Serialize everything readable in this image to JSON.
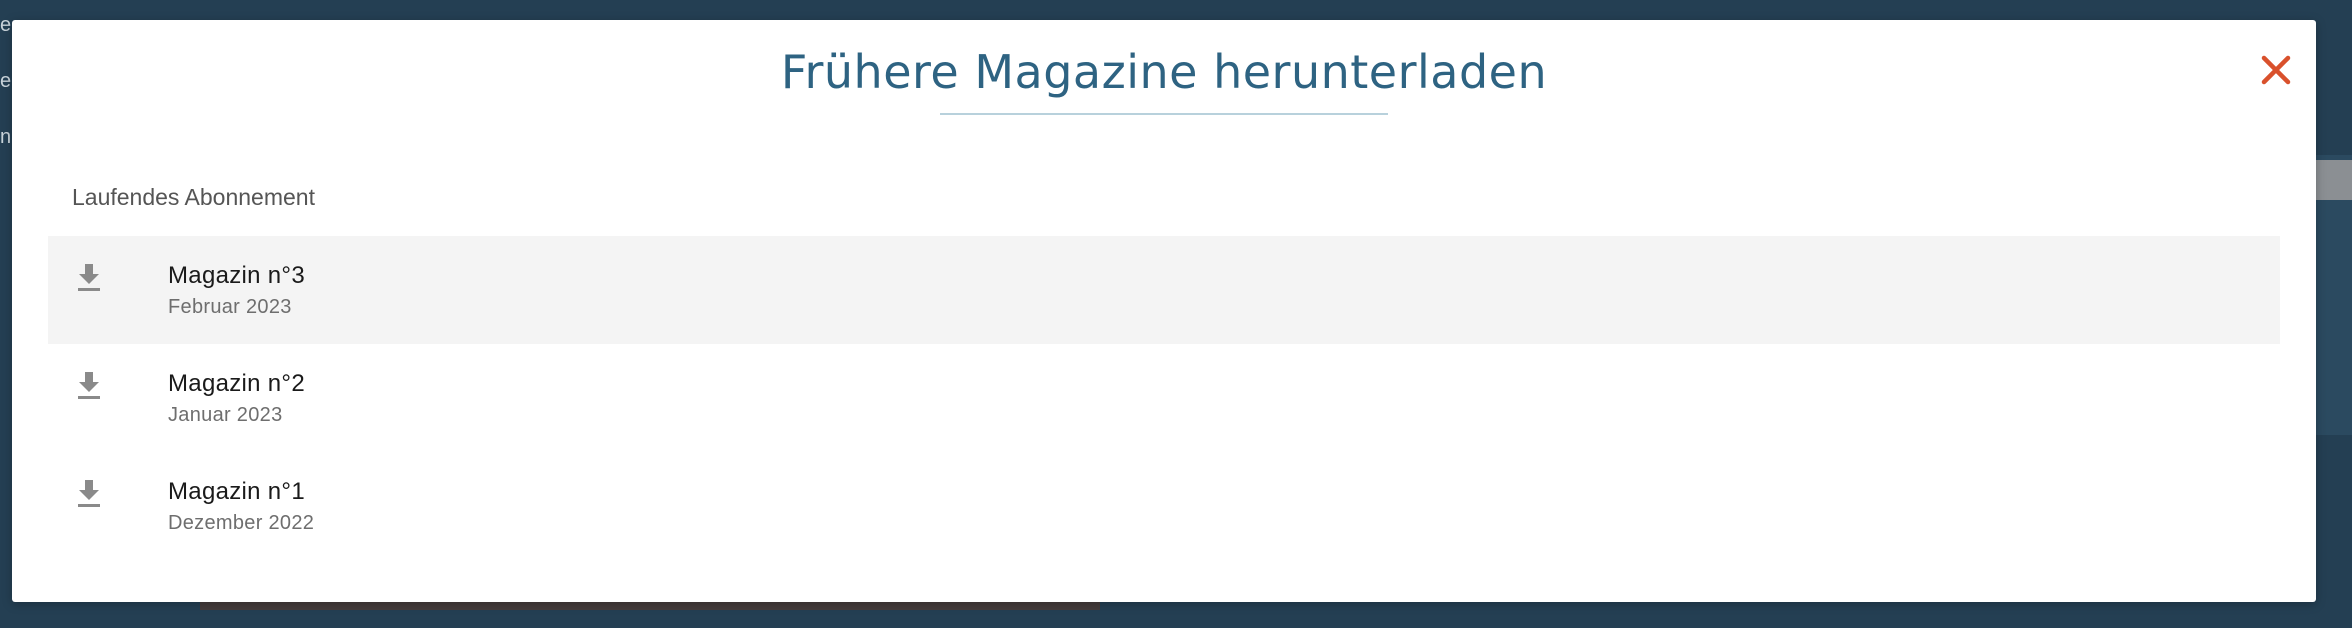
{
  "background": {
    "line_1": "e",
    "line_2": "e",
    "line_3": "n"
  },
  "modal": {
    "title": "Frühere Magazine herunterladen",
    "close_icon": "close-icon",
    "section_label": "Laufendes Abonnement",
    "items": [
      {
        "title": "Magazin n°3",
        "date": "Februar 2023",
        "icon": "download-icon",
        "highlighted": true
      },
      {
        "title": "Magazin n°2",
        "date": "Januar 2023",
        "icon": "download-icon",
        "highlighted": false
      },
      {
        "title": "Magazin n°1",
        "date": "Dezember 2022",
        "icon": "download-icon",
        "highlighted": false
      }
    ]
  },
  "colors": {
    "title": "#2e6382",
    "close": "#d9512c",
    "overlay": "#243f53",
    "highlight_row": "#f4f4f4",
    "icon": "#8a8a8a"
  }
}
